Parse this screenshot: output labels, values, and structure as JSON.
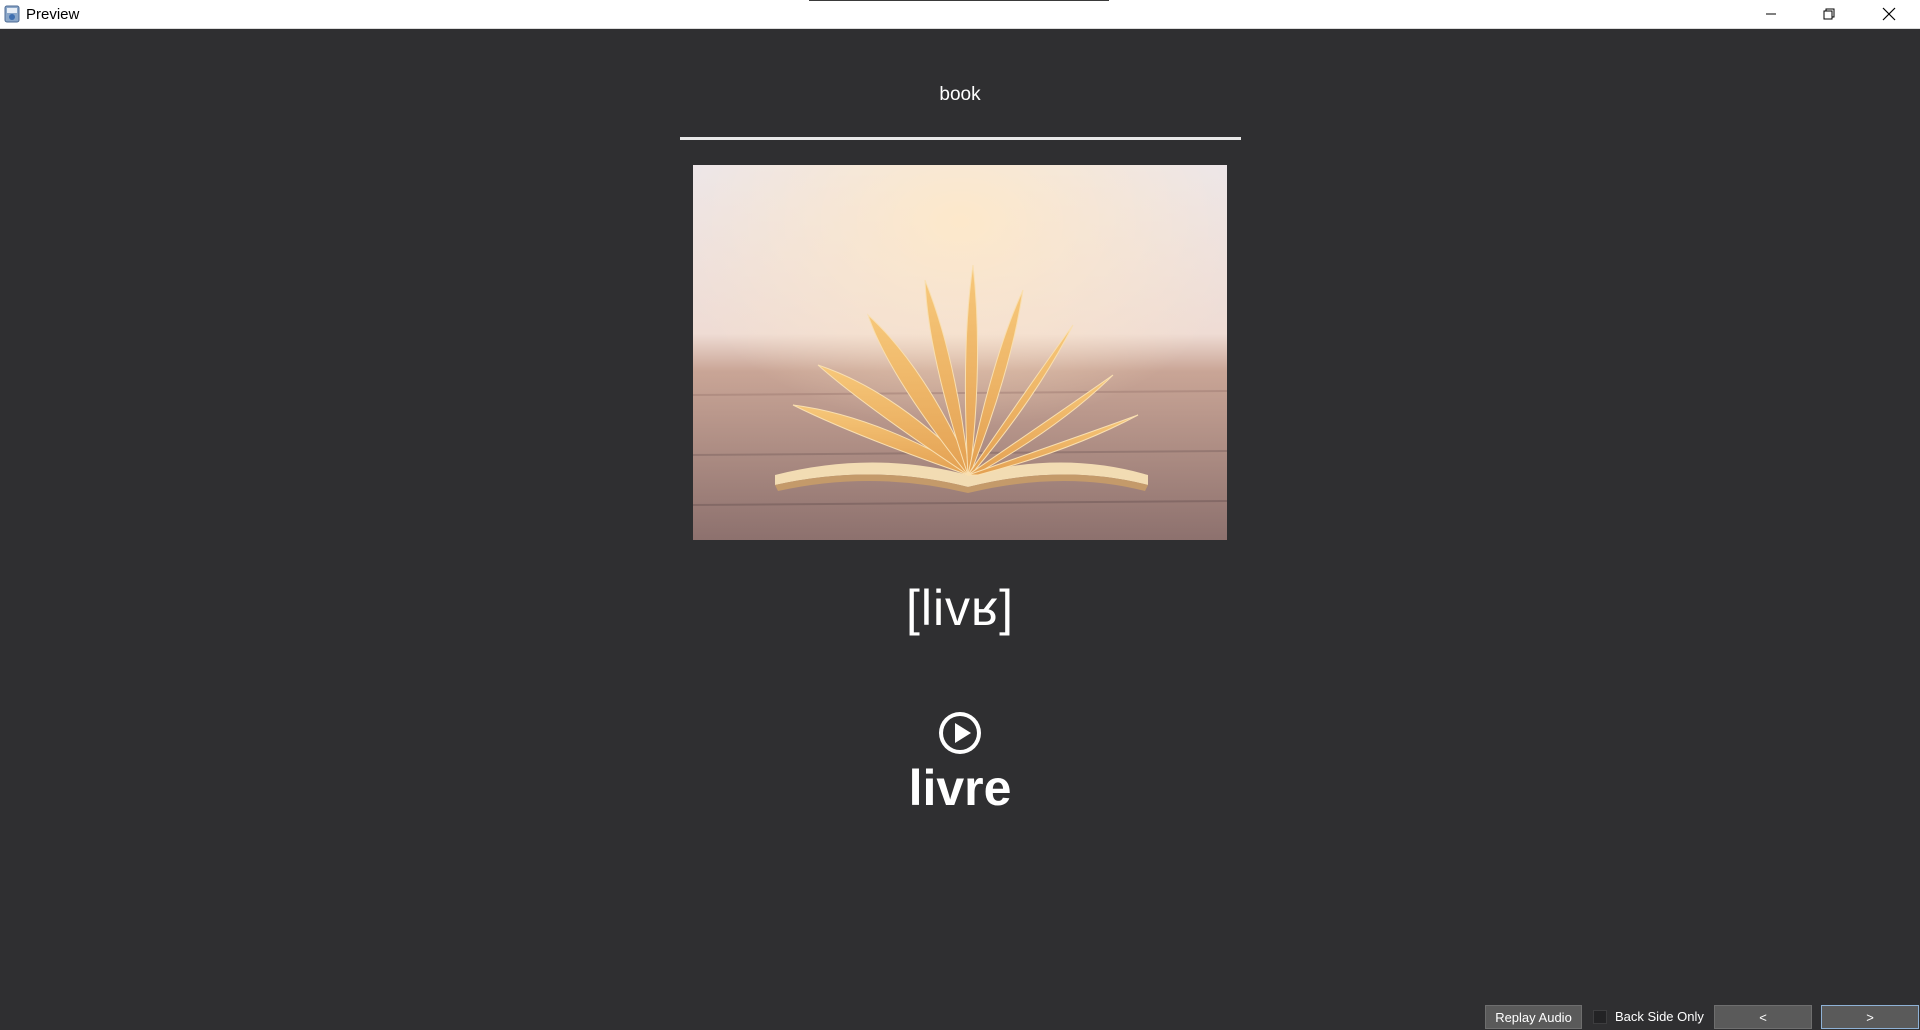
{
  "window": {
    "title": "Preview",
    "icon": "app-icon"
  },
  "card": {
    "front_word": "book",
    "image_description_icon": "open-book-photo",
    "pronunciation": "[livʁ]",
    "audio_icon": "play-circle-icon",
    "back_word": "livre"
  },
  "bottombar": {
    "replay_label": "Replay Audio",
    "back_side_only_label": "Back Side Only",
    "back_side_only_checked": false,
    "prev_label": "<",
    "next_label": ">"
  },
  "colors": {
    "background": "#2f2f31",
    "text": "#ffffff",
    "button": "#5a5a5a",
    "focus_border": "#8fb2d6"
  }
}
